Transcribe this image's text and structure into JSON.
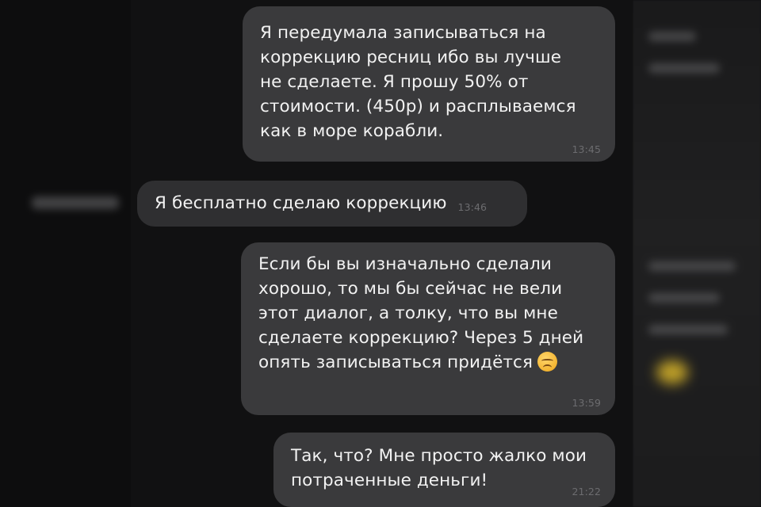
{
  "messages": [
    {
      "direction": "outgoing",
      "text": "Я передумала записываться на\nкоррекцию ресниц ибо вы лучше\nне сделаете. Я прошу 50% от\nстоимости. (450р) и расплываемся\nкак в море корабли.",
      "time": "13:45"
    },
    {
      "direction": "incoming",
      "text": "Я бесплатно сделаю коррекцию",
      "time": "13:46"
    },
    {
      "direction": "outgoing",
      "text": "Если бы вы изначально сделали\nхорошо, то мы бы сейчас не вели\nэтот диалог, а толку, что вы мне\nсделаете коррекцию? Через 5 дней\nопять записываться придётся",
      "emoji": "disappointed-face-emoji",
      "time": "13:59"
    },
    {
      "direction": "outgoing",
      "text": "Так, что? Мне просто жалко мои\nпотраченные деньги!",
      "time": "21:22"
    }
  ],
  "colors": {
    "background": "#0c0c0d",
    "bubble": "#3a3a3c",
    "bubble_incoming": "#2f2f31",
    "text": "#f2f2f2",
    "time": "#6c6c6f"
  }
}
